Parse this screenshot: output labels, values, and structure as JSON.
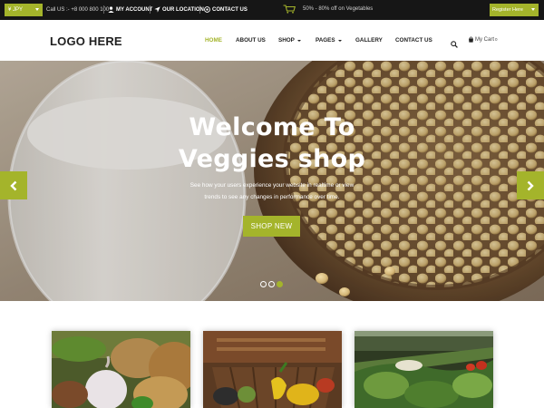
{
  "topbar": {
    "currency": "¥ JPY",
    "call": "Call US :- +8 000 800 100",
    "account": "MY ACCOUNT",
    "location": "OUR LOCATION",
    "contact": "CONTACT US",
    "promo": "50% - 80% off on Vegetables",
    "register": "Register Here"
  },
  "header": {
    "logo": "LOGO HERE",
    "nav": {
      "home": "HOME",
      "about": "ABOUT US",
      "shop": "SHOP",
      "pages": "PAGES",
      "gallery": "GALLERY",
      "contact": "CONTACT US"
    },
    "cart_label": "My Cart",
    "cart_count": "0"
  },
  "hero": {
    "title_line1": "Welcome To",
    "title_line2": "Veggies shop",
    "subtitle_line1": "See how your users experience your website in realtime or view",
    "subtitle_line2": "trends to see any changes in performance over time.",
    "button": "SHOP NEW"
  },
  "icons": {
    "user": "user-icon",
    "location": "location-arrow-icon",
    "contact": "contact-icon",
    "cart_truck": "shopping-cart-icon",
    "search": "search-icon",
    "cart": "shopping-bag-icon",
    "prev": "chevron-left-icon",
    "next": "chevron-right-icon"
  },
  "colors": {
    "accent": "#a4b42b",
    "topbar": "#161616",
    "text_dark": "#1f1f1f"
  }
}
